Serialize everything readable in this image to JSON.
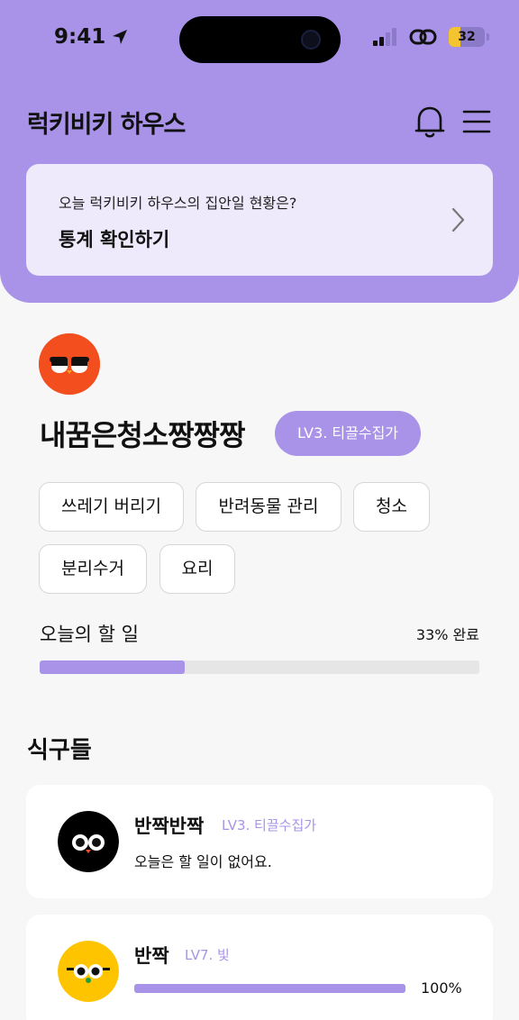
{
  "status_bar": {
    "time": "9:41",
    "battery": "32",
    "location_icon": "location-arrow-icon",
    "signal_icon": "cellular-signal-icon",
    "link_icon": "link-icon"
  },
  "header": {
    "title": "럭키비키 하우스",
    "bell_icon": "bell-icon",
    "menu_icon": "hamburger-menu-icon",
    "color": "#a893e8"
  },
  "stats_card": {
    "subtitle": "오늘 럭키비키 하우스의 집안일 현황은?",
    "action": "통계 확인하기",
    "chevron_icon": "chevron-right-icon"
  },
  "profile": {
    "avatar_icon": "owl-avatar-icon",
    "avatar_color": "#f24e1e",
    "name": "내꿈은청소짱짱짱",
    "level": "LV3. 티끌수집가"
  },
  "chips": [
    "쓰레기 버리기",
    "반려동물 관리",
    "청소",
    "분리수거",
    "요리"
  ],
  "today": {
    "label": "오늘의 할 일",
    "percent_text": "33% 완료",
    "progress": 0.33
  },
  "family": {
    "title": "식구들",
    "members": [
      {
        "name": "반짝반짝",
        "level": "LV3. 티끌수집가",
        "status": "오늘은 할 일이 없어요.",
        "avatar_color": "#000000"
      },
      {
        "name": "반짝",
        "level": "LV7. 빛",
        "percent_text": "100%",
        "progress": 1.0,
        "avatar_color": "#ffc400"
      }
    ]
  }
}
